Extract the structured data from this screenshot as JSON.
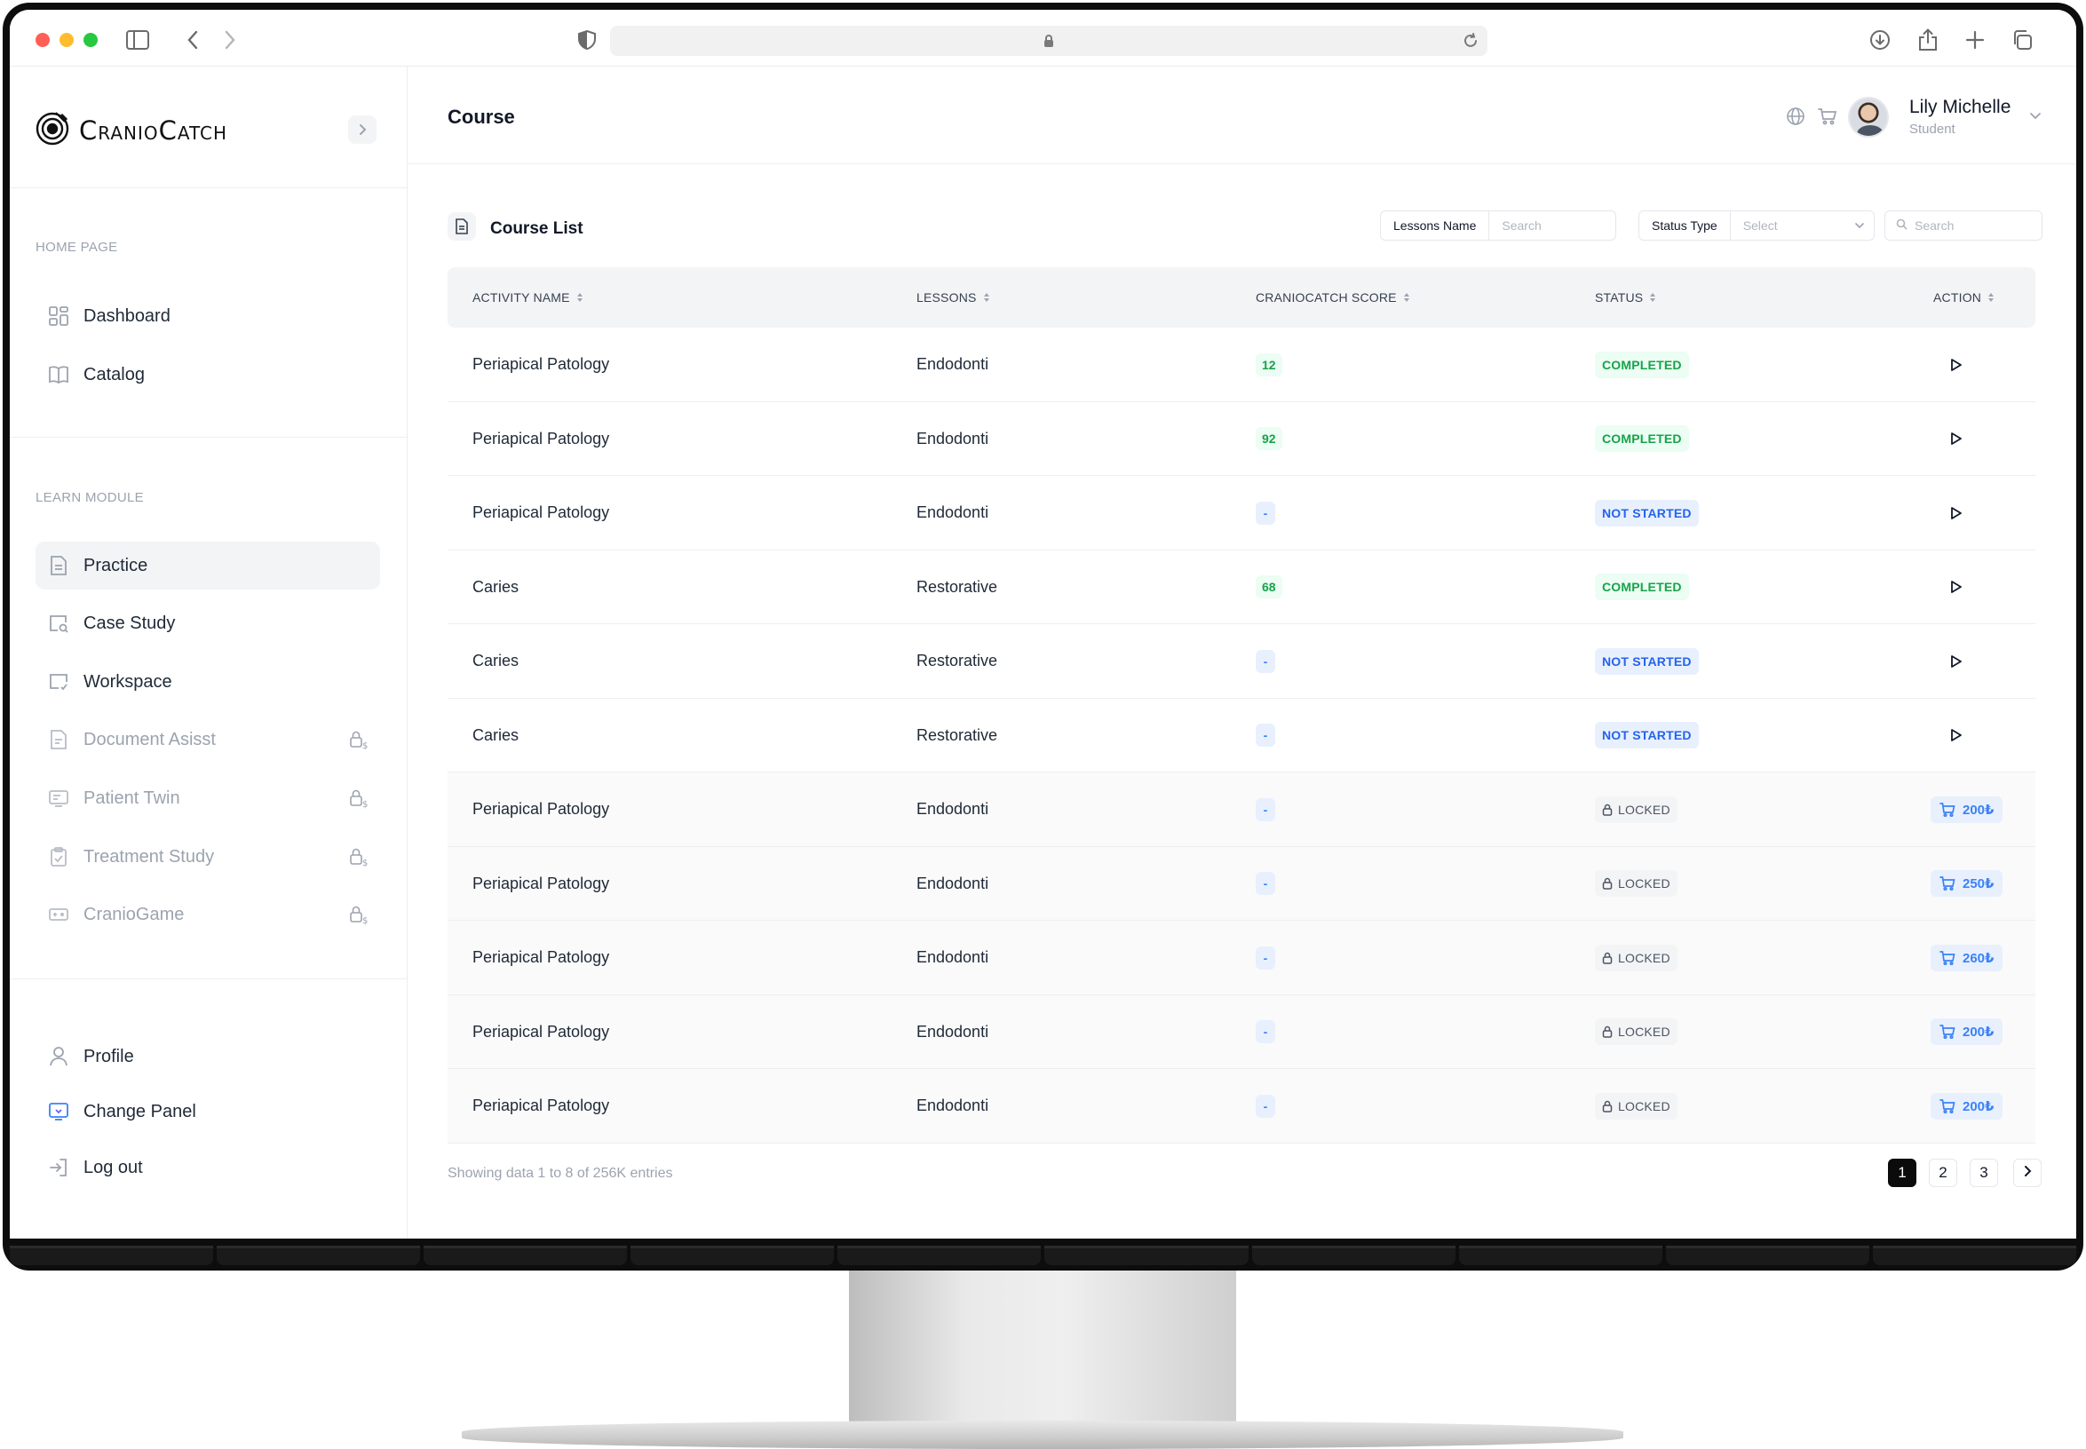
{
  "brand": {
    "name": "CranioCatch"
  },
  "sidebar": {
    "sections": [
      {
        "label": "HOME PAGE"
      },
      {
        "label": "LEARN MODULE"
      }
    ],
    "home_items": [
      {
        "label": "Dashboard",
        "icon": "dashboard-icon"
      },
      {
        "label": "Catalog",
        "icon": "book-icon"
      }
    ],
    "learn_items": [
      {
        "label": "Practice",
        "icon": "document-icon",
        "active": true,
        "locked": false
      },
      {
        "label": "Case Study",
        "icon": "case-study-icon",
        "active": false,
        "locked": false
      },
      {
        "label": "Workspace",
        "icon": "workspace-icon",
        "active": false,
        "locked": false
      },
      {
        "label": "Document Asisst",
        "icon": "document-icon",
        "active": false,
        "locked": true
      },
      {
        "label": "Patient Twin",
        "icon": "patient-icon",
        "active": false,
        "locked": true
      },
      {
        "label": "Treatment Study",
        "icon": "clipboard-icon",
        "active": false,
        "locked": true
      },
      {
        "label": "CranioGame",
        "icon": "gamepad-icon",
        "active": false,
        "locked": true
      }
    ],
    "bottom_items": [
      {
        "label": "Profile",
        "icon": "user-icon"
      },
      {
        "label": "Change Panel",
        "icon": "panel-icon"
      },
      {
        "label": "Log out",
        "icon": "logout-icon"
      }
    ]
  },
  "header": {
    "title": "Course",
    "user": {
      "name": "Lily Michelle",
      "role": "Student"
    }
  },
  "card": {
    "title": "Course List",
    "filters": {
      "lessons_label": "Lessons Name",
      "lessons_placeholder": "Search",
      "status_label": "Status Type",
      "status_placeholder": "Select",
      "search_placeholder": "Search"
    }
  },
  "table": {
    "columns": [
      "ACTIVITY NAME",
      "LESSONS",
      "CRANIOCATCH SCORE",
      "STATUS",
      "ACTION"
    ],
    "rows": [
      {
        "activity": "Periapical Patology",
        "lesson": "Endodonti",
        "score": "12",
        "status": "COMPLETED",
        "action": "play"
      },
      {
        "activity": "Periapical Patology",
        "lesson": "Endodonti",
        "score": "92",
        "status": "COMPLETED",
        "action": "play"
      },
      {
        "activity": "Periapical Patology",
        "lesson": "Endodonti",
        "score": "-",
        "status": "NOT STARTED",
        "action": "play"
      },
      {
        "activity": "Caries",
        "lesson": "Restorative",
        "score": "68",
        "status": "COMPLETED",
        "action": "play"
      },
      {
        "activity": "Caries",
        "lesson": "Restorative",
        "score": "-",
        "status": "NOT STARTED",
        "action": "play"
      },
      {
        "activity": "Caries",
        "lesson": "Restorative",
        "score": "-",
        "status": "NOT STARTED",
        "action": "play"
      },
      {
        "activity": "Periapical Patology",
        "lesson": "Endodonti",
        "score": "-",
        "status": "LOCKED",
        "action": "buy",
        "price": "200₺"
      },
      {
        "activity": "Periapical Patology",
        "lesson": "Endodonti",
        "score": "-",
        "status": "LOCKED",
        "action": "buy",
        "price": "250₺"
      },
      {
        "activity": "Periapical Patology",
        "lesson": "Endodonti",
        "score": "-",
        "status": "LOCKED",
        "action": "buy",
        "price": "260₺"
      },
      {
        "activity": "Periapical Patology",
        "lesson": "Endodonti",
        "score": "-",
        "status": "LOCKED",
        "action": "buy",
        "price": "200₺"
      },
      {
        "activity": "Periapical Patology",
        "lesson": "Endodonti",
        "score": "-",
        "status": "LOCKED",
        "action": "buy",
        "price": "200₺"
      }
    ]
  },
  "footer": {
    "info": "Showing data 1 to 8 of  256K entries",
    "pages": [
      "1",
      "2",
      "3"
    ],
    "current_page": "1"
  },
  "colors": {
    "completed": "#16a34a",
    "not_started": "#2563eb",
    "active_page": "#0b0b0b"
  }
}
